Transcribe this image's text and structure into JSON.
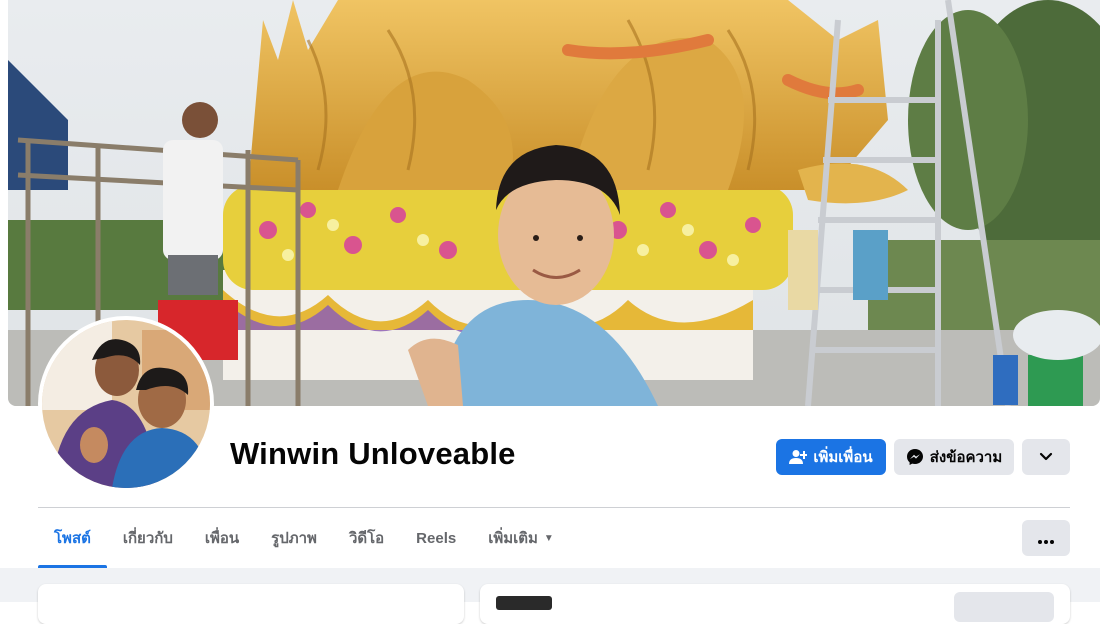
{
  "profile": {
    "name": "Winwin Unloveable"
  },
  "actions": {
    "add_friend_label": "เพิ่มเพื่อน",
    "add_friend_icon": "add-friend-icon",
    "message_label": "ส่งข้อความ",
    "message_icon": "messenger-icon",
    "more_icon": "chevron-down-icon"
  },
  "tabs": [
    {
      "label": "โพสต์",
      "active": true
    },
    {
      "label": "เกี่ยวกับ"
    },
    {
      "label": "เพื่อน"
    },
    {
      "label": "รูปภาพ"
    },
    {
      "label": "วิดีโอ"
    },
    {
      "label": "Reels"
    },
    {
      "label": "เพิ่มเติม",
      "caret": "▼"
    }
  ],
  "tab_more_icon": "more-horizontal-icon",
  "colors": {
    "accent": "#1b74e4",
    "secondary_button": "#e4e6eb",
    "muted_text": "#65676b",
    "feed_background": "#f0f2f5"
  }
}
